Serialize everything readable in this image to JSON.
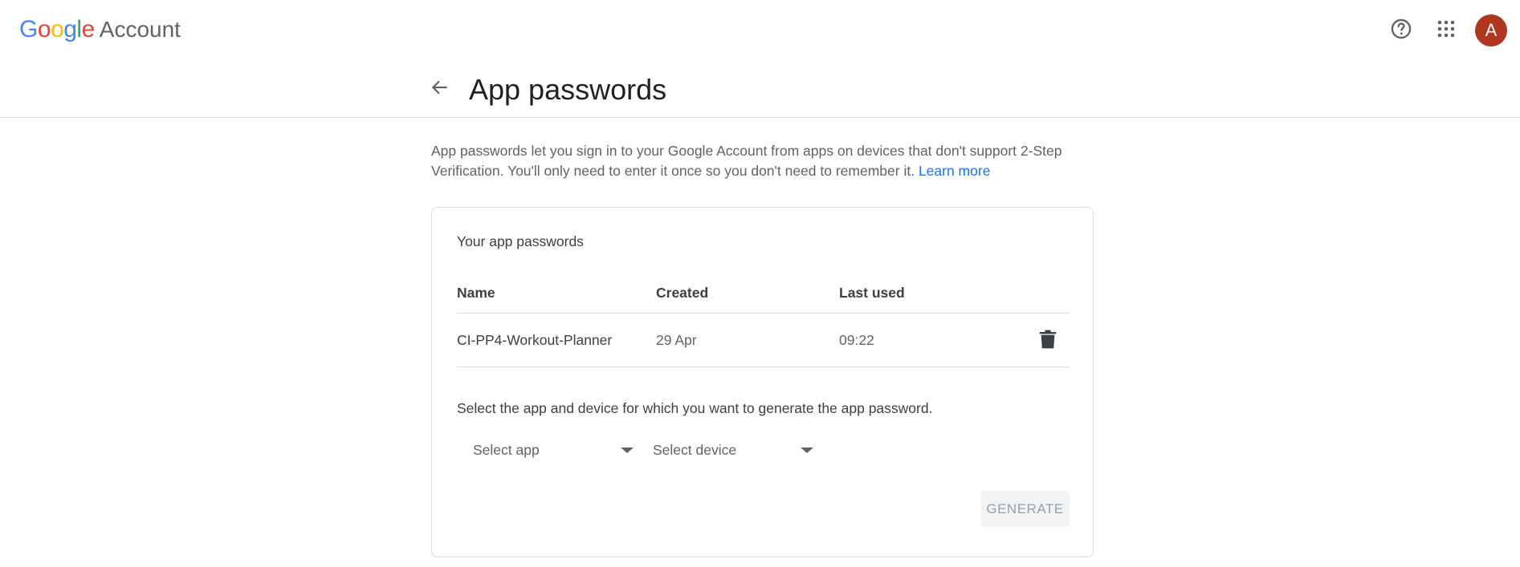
{
  "header": {
    "brand_google_letters": [
      "G",
      "o",
      "o",
      "g",
      "l",
      "e"
    ],
    "brand_google_colors": [
      "#4285F4",
      "#EA4335",
      "#FBBC05",
      "#4285F4",
      "#34A853",
      "#EA4335"
    ],
    "brand_account": "Account",
    "help_icon": "help-circle-icon",
    "apps_icon": "apps-grid-icon",
    "avatar_letter": "A",
    "avatar_color": "#B0361F"
  },
  "page": {
    "title": "App passwords",
    "back_icon": "arrow-back-icon"
  },
  "description": {
    "text": "App passwords let you sign in to your Google Account from apps on devices that don't support 2-Step Verification. You'll only need to enter it once so you don't need to remember it.",
    "link": "Learn more",
    "link_color": "#1a73e8"
  },
  "card": {
    "title": "Your app passwords",
    "columns": [
      "Name",
      "Created",
      "Last used"
    ],
    "rows": [
      {
        "name": "CI-PP4-Workout-Planner",
        "created": "29 Apr",
        "last_used": "09:22",
        "action_icon": "trash-icon"
      }
    ],
    "select_label": "Select the app and device for which you want to generate the app password.",
    "select_app": "Select app",
    "select_device": "Select device",
    "generate_label": "GENERATE"
  }
}
